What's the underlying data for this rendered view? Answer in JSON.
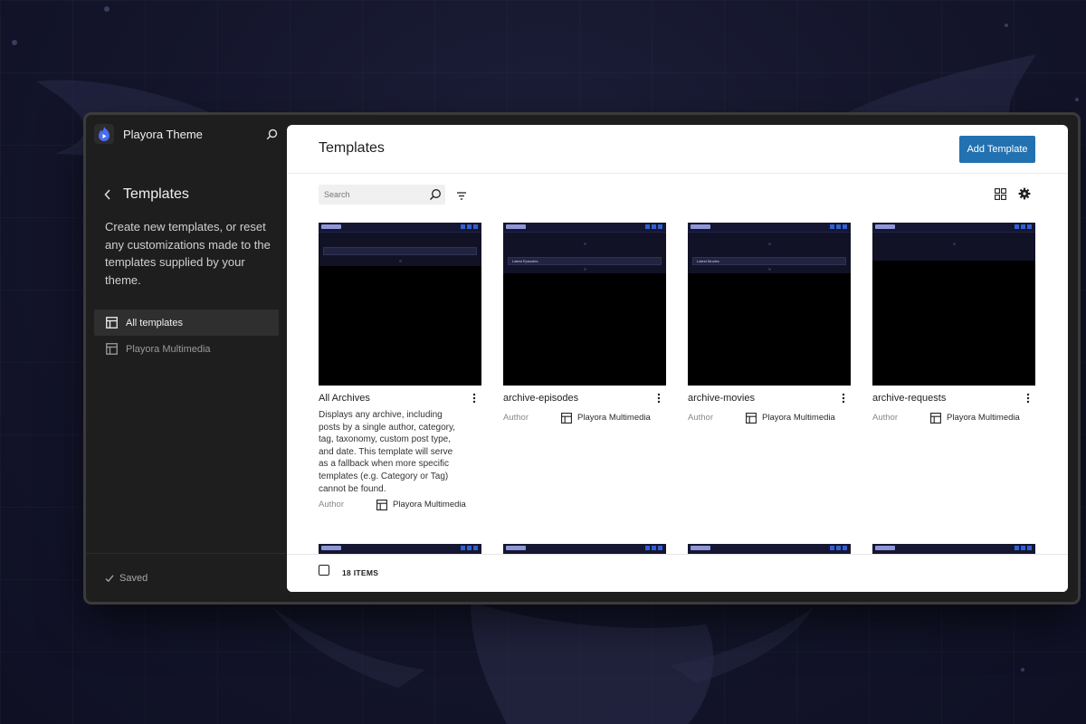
{
  "sidebar": {
    "site_title": "Playora Theme",
    "section_title": "Templates",
    "description": "Create new templates, or reset any customizations made to the templates supplied by your theme.",
    "menu": [
      {
        "label": "All templates",
        "active": true,
        "icon": "layout-icon"
      },
      {
        "label": "Playora Multimedia",
        "active": false,
        "icon": "layout-icon"
      }
    ],
    "status": "Saved"
  },
  "main": {
    "title": "Templates",
    "add_button": "Add Template",
    "search_placeholder": "Search",
    "items_count": "18 ITEMS"
  },
  "templates": [
    {
      "title": "All Archives",
      "description": "Displays any archive, including posts by a single author, category, tag, taxonomy, custom post type, and date. This template will serve as a fallback when more specific templates (e.g. Category or Tag) cannot be found.",
      "author_label": "Author",
      "source": "Playora Multimedia"
    },
    {
      "title": "archive-episodes",
      "description": "",
      "author_label": "Author",
      "source": "Playora Multimedia",
      "preview_label": "Latest Episodes"
    },
    {
      "title": "archive-movies",
      "description": "",
      "author_label": "Author",
      "source": "Playora Multimedia",
      "preview_label": "Latest Movies"
    },
    {
      "title": "archive-requests",
      "description": "",
      "author_label": "Author",
      "source": "Playora Multimedia"
    }
  ],
  "colors": {
    "accent": "#2271b1",
    "sidebar_bg": "#1e1e1e",
    "background": "#14152b"
  }
}
